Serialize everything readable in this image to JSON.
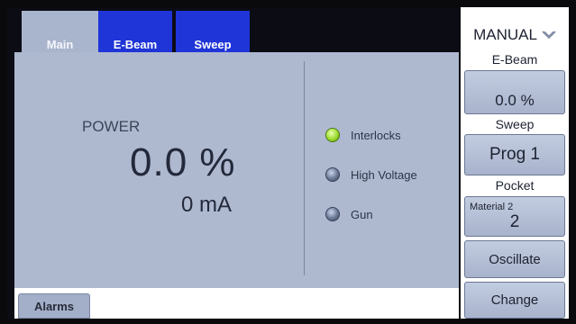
{
  "tabs": {
    "main": "Main",
    "ebeam": "E-Beam",
    "sweep": "Sweep"
  },
  "power": {
    "label": "POWER",
    "value": "0.0 %",
    "current": "0 mA"
  },
  "status_indicators": [
    {
      "label": "Interlocks",
      "state": "on",
      "color": "#9ddb2e"
    },
    {
      "label": "High Voltage",
      "state": "off",
      "color": "#6a7894"
    },
    {
      "label": "Gun",
      "state": "off",
      "color": "#6a7894"
    }
  ],
  "bottom_bar": {
    "alarms_label": "Alarms"
  },
  "right_panel": {
    "mode": "MANUAL",
    "mode_icon": "chevron-down-icon",
    "ebeam_label": "E-Beam",
    "ebeam_value": "0.0 %",
    "sweep_label": "Sweep",
    "sweep_value": "Prog 1",
    "pocket_label": "Pocket",
    "pocket_material": "Material 2",
    "pocket_number": "2",
    "oscillate_label": "Oscillate",
    "change_label": "Change"
  },
  "colors": {
    "tab_active": "#1f35d8",
    "panel_bg": "#aeb9d0"
  }
}
